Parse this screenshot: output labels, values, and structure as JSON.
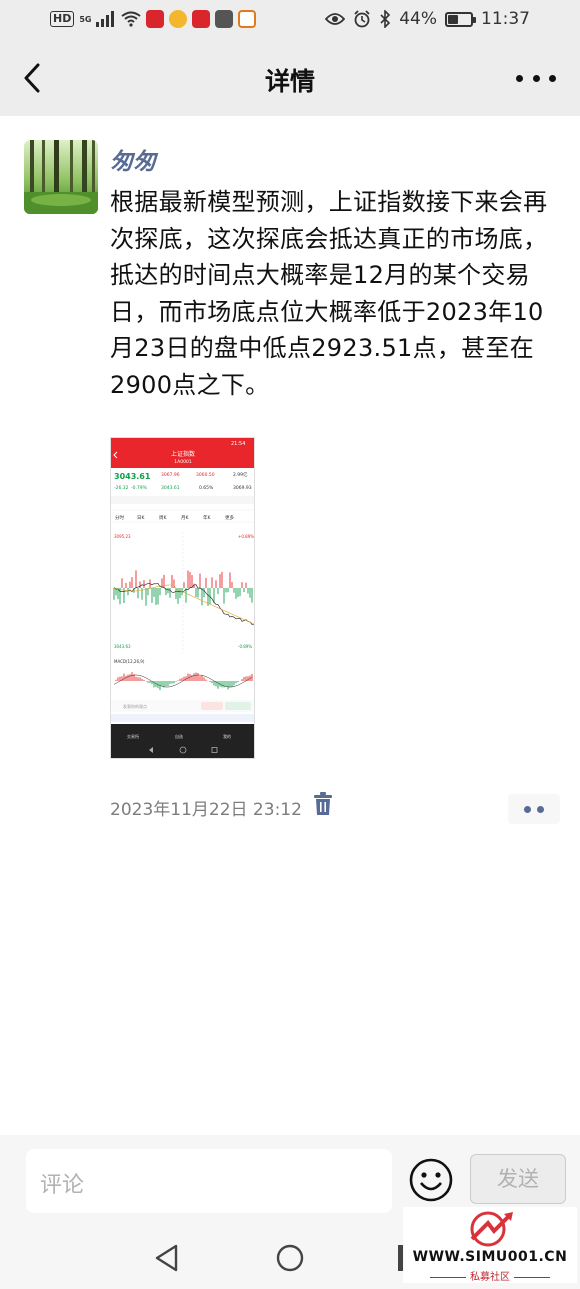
{
  "status_bar": {
    "hd": "HD",
    "network": "5G",
    "battery_text": "44%",
    "battery_level": 0.44,
    "time": "11:37"
  },
  "nav": {
    "title": "详情"
  },
  "post": {
    "username": "匆匆",
    "text": "根据最新模型预测，上证指数接下来会再次探底，这次探底会抵达真正的市场底，抵达的时间点大概率是12月的某个交易日，而市场底点位大概率低于2023年10月23日的盘中低点2923.51点，甚至在2900点之下。",
    "timestamp": "2023年11月22日 23:12"
  },
  "screenshot": {
    "time": "21:54",
    "title": "上证指数",
    "code": "1A0001",
    "price": "3043.61",
    "change": "-26.32",
    "pct": "-0.79%",
    "high": "3067.96",
    "open": "3060.50",
    "amount": "2.99亿",
    "low": "3043.61",
    "turnover": "0.65%",
    "prev_close": "3069.93",
    "tabs": [
      "分时",
      "日K",
      "周K",
      "月K",
      "年K",
      "更多"
    ],
    "top_price": "3095.23",
    "top_pct": "+0.89%",
    "bottom_price": "3043.63",
    "bottom_pct": "-0.89%",
    "macd": "MACD(12,26,9)",
    "input_hint": "发表你的观点",
    "nav_items": [
      "交易所",
      "自选",
      "我的"
    ]
  },
  "comment": {
    "placeholder": "评论",
    "send_label": "发送"
  },
  "watermark": {
    "site": "WWW.SIMU001.CN",
    "sub": "私募社区"
  },
  "colors": {
    "link_blue": "#576b95",
    "header_bg": "#ededed",
    "stock_red": "#e8262c"
  }
}
